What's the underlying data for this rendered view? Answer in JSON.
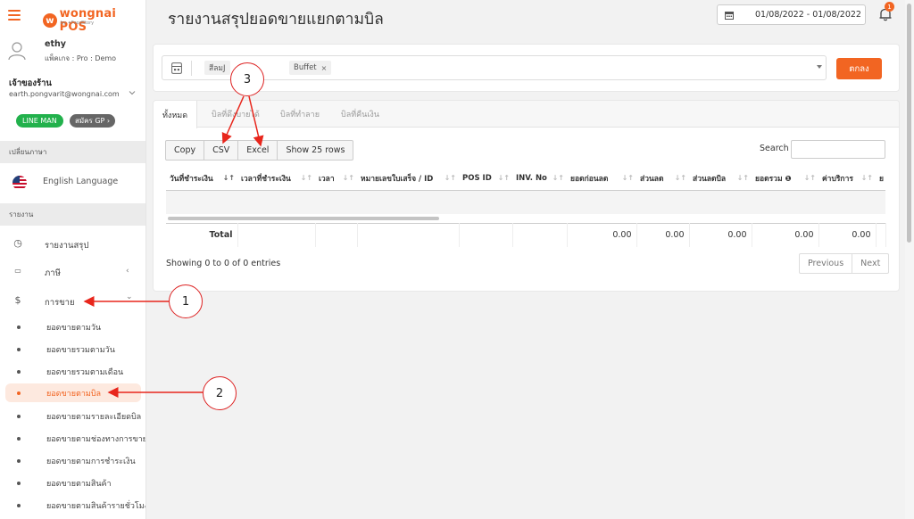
{
  "sidebar": {
    "logo": {
      "mark": "w",
      "name": "wongnai POS",
      "sub": "by ✦FoodStory"
    },
    "user": {
      "name": "ethy",
      "plan": "แพ็คเกจ : Pro : Demo"
    },
    "owner": {
      "label": "เจ้าของร้าน",
      "email": "earth.pongvarit@wongnai.com"
    },
    "badges": {
      "lineman": "LINE MAN",
      "gp": "สมัคร GP ›"
    },
    "language_section": "เปลี่ยนภาษา",
    "language_item": "English Language",
    "report_section": "รายงาน",
    "menu": [
      {
        "label": "รายงานสรุป",
        "icon": "◷"
      },
      {
        "label": "ภาษี",
        "icon": "▭",
        "chevron": "‹"
      },
      {
        "label": "การขาย",
        "icon": "$",
        "chevron": "⌄"
      }
    ],
    "sub_items": [
      "ยอดขายตามวัน",
      "ยอดขายรวมตามวัน",
      "ยอดขายรวมตามเดือน",
      "ยอดขายตามบิล",
      "ยอดขายตามรายละเอียดบิล",
      "ยอดขายตามช่องทางการขาย",
      "ยอดขายตามการชำระเงิน",
      "ยอดขายตามสินค้า",
      "ยอดขายตามสินค้ารายชั่วโมง"
    ]
  },
  "header": {
    "title": "รายงานสรุปยอดขายแยกตามบิล",
    "date_range": "01/08/2022 - 01/08/2022",
    "notification_count": "1"
  },
  "filter": {
    "tags": [
      "สีลมJ",
      "Buffet"
    ],
    "tag_remove": "×",
    "ok_label": "ตกลง"
  },
  "table": {
    "tabs": [
      "ทั้งหมด",
      "บิลที่ดึงบายได้",
      "บิลที่ทำลาย",
      "บิลที่คืนเงิน"
    ],
    "buttons": [
      "Copy",
      "CSV",
      "Excel",
      "Show 25 rows"
    ],
    "search_label": "Search",
    "columns": [
      "วันที่ชำระเงิน",
      "เวลาที่ชำระเงิน",
      "เวลา",
      "หมายเลขใบเสร็จ / ID",
      "POS ID",
      "INV. No",
      "ยอดก่อนลด",
      "ส่วนลด",
      "ส่วนลดบิล",
      "ยอดรวม ❶",
      "ค่าบริการ",
      "ย"
    ],
    "total_label": "Total",
    "totals": [
      "0.00",
      "0.00",
      "0.00",
      "0.00",
      "0.00"
    ],
    "showing": "Showing 0 to 0 of 0 entries",
    "prev": "Previous",
    "next": "Next"
  },
  "callouts": [
    "1",
    "2",
    "3"
  ]
}
